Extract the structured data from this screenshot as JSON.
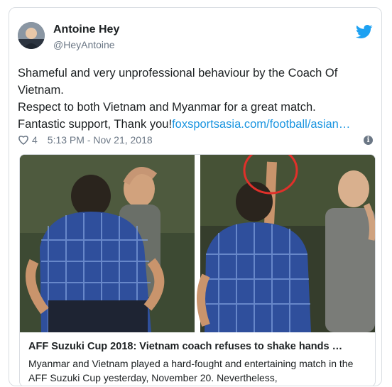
{
  "tweet": {
    "author_name": "Antoine Hey",
    "author_handle": "@HeyAntoine",
    "line1": "Shameful and very unprofessional  behaviour by the Coach Of Vietnam.",
    "line2": "Respect to both Vietnam and Myanmar for a great match.",
    "line3": "Fantastic support, Thank you!",
    "link_text": "foxsportsasia.com/football/asian…",
    "like_count": "4",
    "timestamp": "5:13 PM - Nov 21, 2018",
    "info_glyph": "i"
  },
  "link_card": {
    "title": "AFF Suzuki Cup 2018: Vietnam coach refuses to shake hands …",
    "description": "Myanmar and Vietnam played a hard-fought and entertaining match in the AFF Suzuki Cup yesterday, November 20. Nevertheless,"
  },
  "icons": {
    "bird": "twitter-bird-icon",
    "heart": "heart-icon",
    "info": "info-icon"
  },
  "colors": {
    "link": "#1b95e0",
    "text": "#1c2022",
    "muted": "#6b7785",
    "highlight_circle": "#e0302a"
  }
}
